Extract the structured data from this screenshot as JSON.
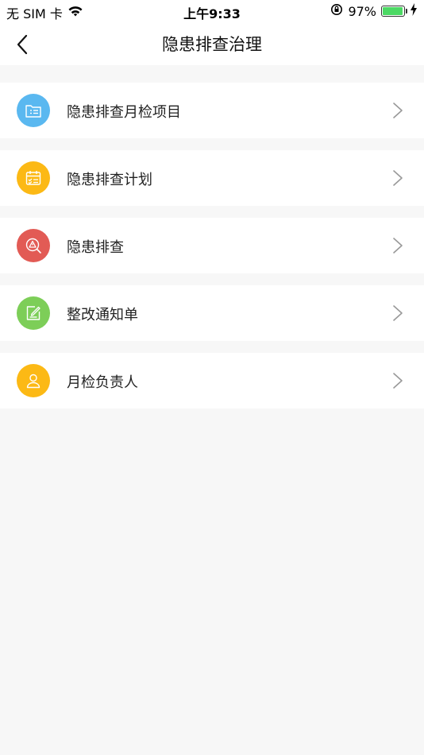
{
  "status_bar": {
    "carrier": "无 SIM 卡",
    "time": "上午9:33",
    "battery": "97%",
    "battery_level": 0.97,
    "battery_color": "#4cd964"
  },
  "nav": {
    "title": "隐患排查治理",
    "back_icon": "chevron-left-icon"
  },
  "menu": [
    {
      "label": "隐患排查月检项目",
      "icon": "folder-list-icon",
      "color": "#5ab8f0"
    },
    {
      "label": "隐患排查计划",
      "icon": "calendar-check-icon",
      "color": "#fcb915"
    },
    {
      "label": "隐患排查",
      "icon": "warning-search-icon",
      "color": "#e25b55"
    },
    {
      "label": "整改通知单",
      "icon": "edit-note-icon",
      "color": "#7dce58"
    },
    {
      "label": "月检负责人",
      "icon": "person-icon",
      "color": "#fcb915"
    }
  ]
}
